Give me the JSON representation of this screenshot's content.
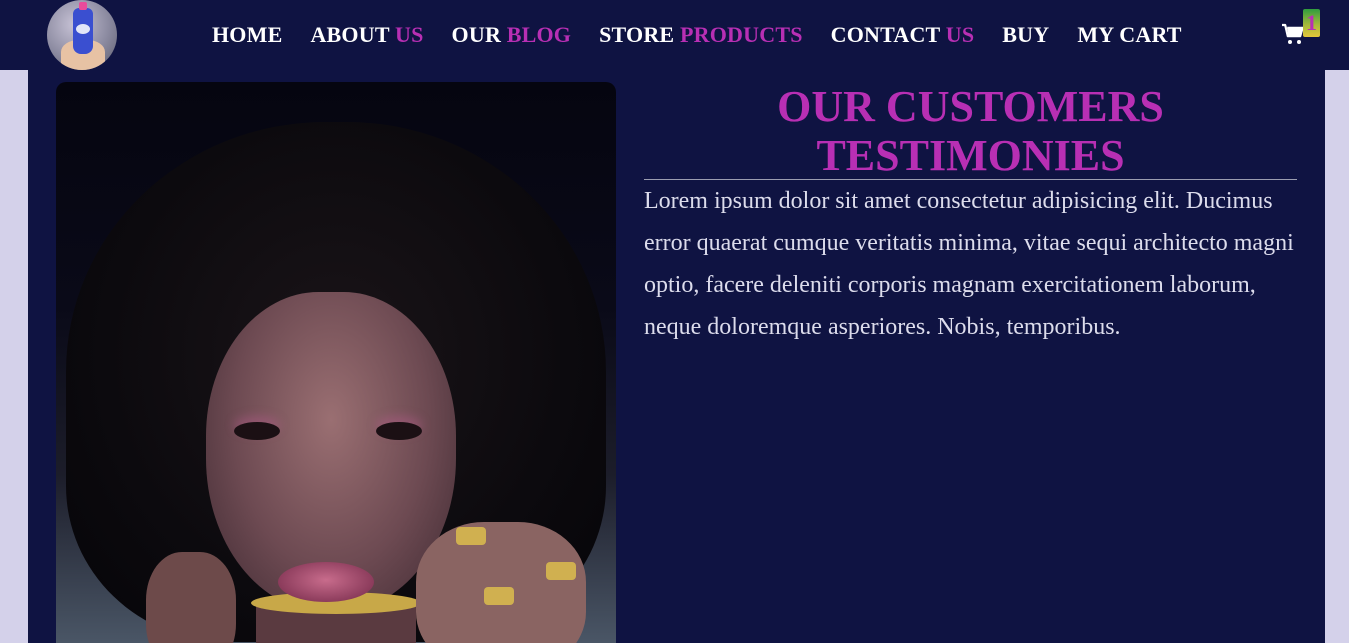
{
  "nav": {
    "links": [
      {
        "main": "HOME",
        "accent": ""
      },
      {
        "main": "ABOUT",
        "accent": "US"
      },
      {
        "main": "OUR",
        "accent": "BLOG"
      },
      {
        "main": "STORE",
        "accent": "PRODUCTS"
      },
      {
        "main": "CONTACT",
        "accent": "US"
      },
      {
        "main": "BUY",
        "accent": ""
      },
      {
        "main": "MY CART",
        "accent": ""
      }
    ],
    "cart_count": "1"
  },
  "testimonial": {
    "title": "OUR CUSTOMERS TESTIMONIES",
    "body": "Lorem ipsum dolor sit amet consectetur adipisicing elit. Ducimus error quaerat cumque veritatis minima, vitae sequi architecto magni optio, facere deleniti corporis magnam exercitationem laborum, neque doloremque asperiores. Nobis, temporibus."
  },
  "colors": {
    "navy": "#0f1342",
    "accent_magenta": "#b82fb4",
    "page_background": "#d4d1ea",
    "text_light": "#dcdcec"
  },
  "icons": {
    "logo": "product-logo-icon",
    "cart": "shopping-cart-icon"
  }
}
